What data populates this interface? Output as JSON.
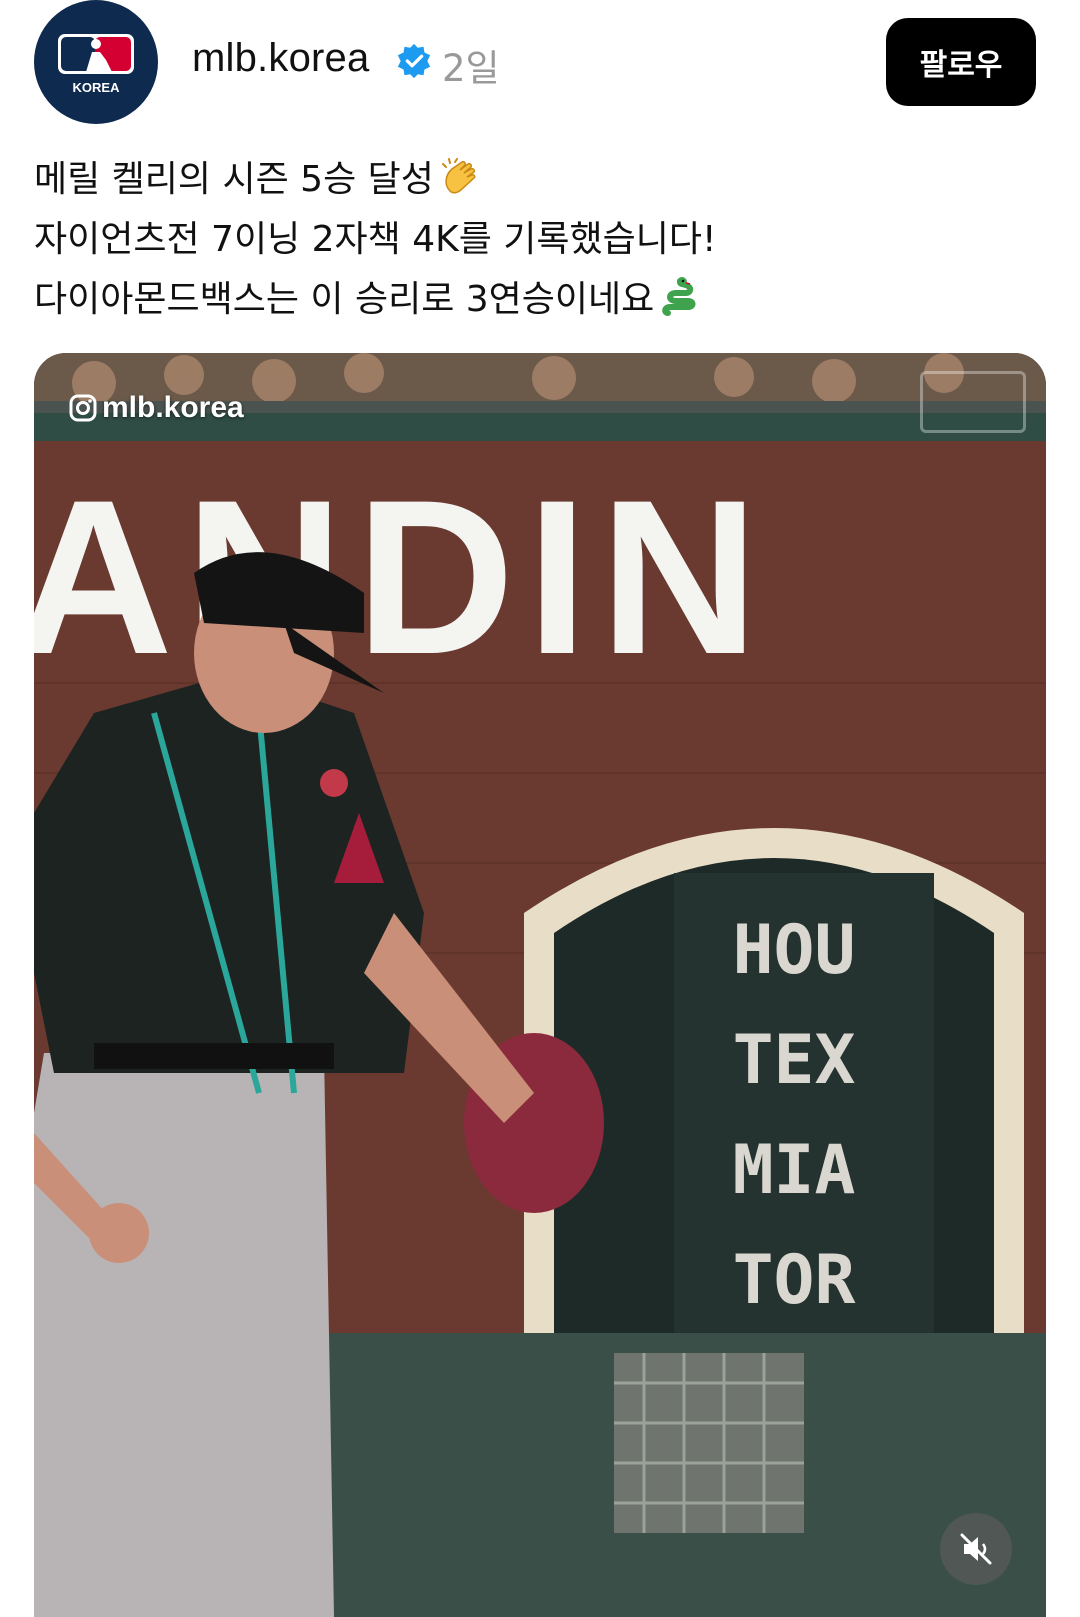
{
  "post": {
    "username": "mlb.korea",
    "time_ago": "2일",
    "follow_label": "팔로우",
    "avatar_text": "KOREA"
  },
  "caption": {
    "line1": "메릴 켈리의 시즌 5승 달성",
    "line2": "자이언츠전 7이닝 2자책 4K를 기록했습니다!",
    "line3": "다이아몬드백스는 이 승리로 3연승이네요",
    "emoji1": "clapping-hands-icon",
    "emoji2": "snake-icon"
  },
  "media": {
    "watermark": "mlb.korea",
    "sign_text": "ANDIN",
    "scoreboard": [
      "HOU",
      "TEX",
      "MIA",
      "TOR"
    ],
    "muted": true
  },
  "colors": {
    "brand_navy": "#0f2a4f",
    "mlb_red": "#d50032",
    "verified_blue": "#1d9bf0",
    "follow_bg": "#000000"
  }
}
